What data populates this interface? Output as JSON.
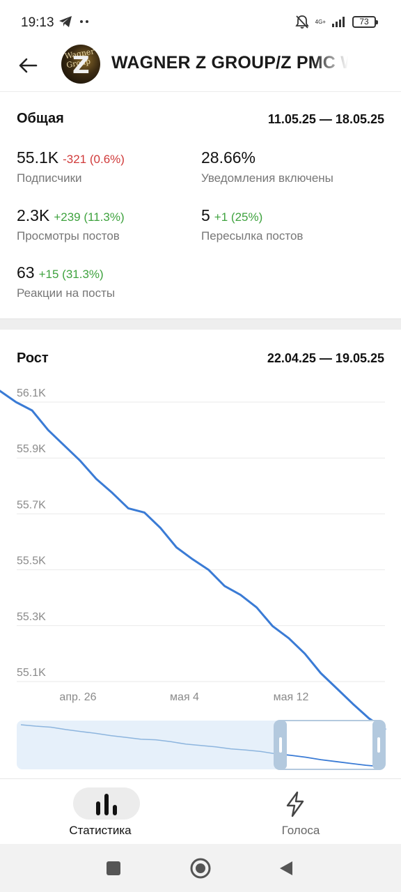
{
  "status_bar": {
    "time": "19:13",
    "network": "4G+",
    "battery": "73"
  },
  "header": {
    "title": "WAGNER Z GROUP/Z PMC W",
    "avatar_text": "Wagner Group",
    "avatar_letter": "Z"
  },
  "overview": {
    "title": "Общая",
    "range": "11.05.25 — 18.05.25",
    "stats": [
      {
        "value": "55.1K",
        "delta": "-321",
        "pct": "(0.6%)",
        "trend": "down",
        "label": "Подписчики"
      },
      {
        "value": "28.66%",
        "delta": "",
        "pct": "",
        "trend": "none",
        "label": "Уведомления включены"
      },
      {
        "value": "2.3K",
        "delta": "+239",
        "pct": "(11.3%)",
        "trend": "up",
        "label": "Просмотры постов"
      },
      {
        "value": "5",
        "delta": "+1",
        "pct": "(25%)",
        "trend": "up",
        "label": "Пересылка постов"
      },
      {
        "value": "63",
        "delta": "+15",
        "pct": "(31.3%)",
        "trend": "up",
        "label": "Реакции на посты"
      }
    ]
  },
  "growth": {
    "title": "Рост",
    "range": "22.04.25 — 19.05.25"
  },
  "chart_data": {
    "type": "line",
    "title": "Рост",
    "x": [
      "22.04",
      "23.04",
      "24.04",
      "25.04",
      "26.04",
      "27.04",
      "28.04",
      "29.04",
      "30.04",
      "01.05",
      "02.05",
      "03.05",
      "04.05",
      "05.05",
      "06.05",
      "07.05",
      "08.05",
      "09.05",
      "10.05",
      "11.05",
      "12.05",
      "13.05",
      "14.05",
      "15.05",
      "16.05",
      "17.05",
      "18.05",
      "19.05"
    ],
    "y": [
      56100,
      56070,
      56000,
      55945,
      55890,
      55825,
      55775,
      55720,
      55705,
      55650,
      55580,
      55538,
      55500,
      55442,
      55410,
      55365,
      55298,
      55255,
      55200,
      55130,
      55075,
      55020,
      54968,
      54930
    ],
    "y_full": [
      56140,
      56100,
      56070,
      56000,
      55945,
      55890,
      55825,
      55775,
      55720,
      55705,
      55650,
      55580,
      55538,
      55500,
      55442,
      55410,
      55365,
      55298,
      55255,
      55200,
      55130,
      55075,
      55020,
      54968,
      54930
    ],
    "ylim": [
      54930,
      56180
    ],
    "yticks": [
      56100,
      55900,
      55700,
      55500,
      55300,
      55100
    ],
    "ytick_labels": [
      "56.1K",
      "55.9K",
      "55.7K",
      "55.5K",
      "55.3K",
      "55.1K"
    ],
    "xtick_labels": [
      "апр. 26",
      "мая 4",
      "мая 12"
    ],
    "grid": true,
    "line_color": "#3a7bd5"
  },
  "tabs": [
    {
      "label": "Статистика",
      "icon": "bar-chart-icon",
      "active": true
    },
    {
      "label": "Голоса",
      "icon": "lightning-icon",
      "active": false
    }
  ],
  "colors": {
    "accent": "#3a7bd5",
    "negative": "#d03a3a",
    "positive": "#3ea23e"
  }
}
